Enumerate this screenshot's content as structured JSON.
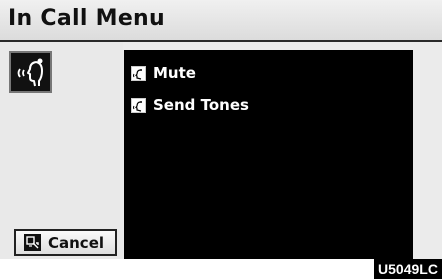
{
  "header": {
    "title": "In Call Menu"
  },
  "left_panel": {
    "voice_icon": "voice-command-icon",
    "cancel_label": "Cancel",
    "cancel_icon": "cancel-icon"
  },
  "menu": {
    "items": [
      {
        "label": "Mute",
        "icon": "voice-prompt-icon"
      },
      {
        "label": "Send Tones",
        "icon": "voice-prompt-icon"
      }
    ]
  },
  "figure_code": "U5049LC"
}
